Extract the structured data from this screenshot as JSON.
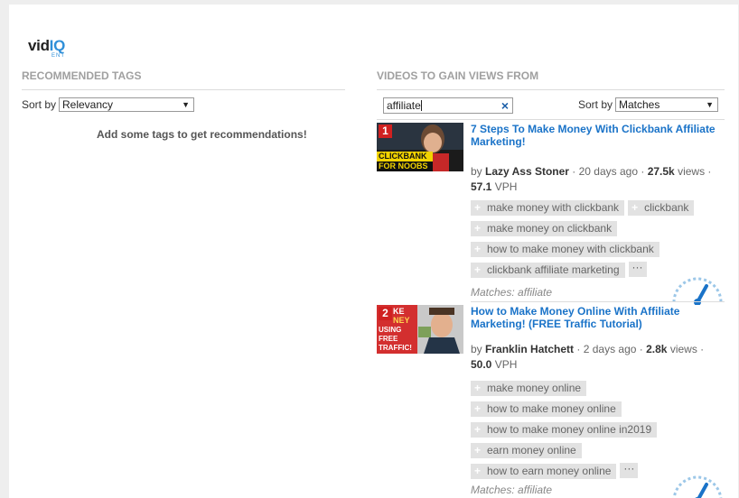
{
  "logo": {
    "text_a": "vid",
    "text_b": "IQ",
    "sub": "ENT"
  },
  "left": {
    "title": "RECOMMENDED TAGS",
    "sort_label": "Sort by",
    "sort_value": "Relevancy",
    "empty_message": "Add some tags to get recommendations!"
  },
  "right": {
    "title": "VIDEOS TO GAIN VIEWS FROM",
    "search_value": "affiliate",
    "sort_label": "Sort by",
    "sort_value": "Matches"
  },
  "videos": [
    {
      "rank": "1",
      "title": "7 Steps To Make Money With Clickbank Affiliate Marketing!",
      "by": "by",
      "channel": "Lazy Ass Stoner",
      "age": "20 days ago",
      "views": "27.5k",
      "views_label": "views",
      "vph": "57.1",
      "vph_label": "VPH",
      "tags": [
        "make money with clickbank",
        "clickbank",
        "make money on clickbank",
        "how to make money with clickbank",
        "clickbank affiliate marketing"
      ],
      "matches": "Matches: affiliate",
      "thumb_text": [
        "CLICKBANK",
        "FOR NOOBS"
      ]
    },
    {
      "rank": "2",
      "title": "How to Make Money Online With Affiliate Marketing! (FREE Traffic Tutorial)",
      "by": "by",
      "channel": "Franklin Hatchett",
      "age": "2 days ago",
      "views": "2.8k",
      "views_label": "views",
      "vph": "50.0",
      "vph_label": "VPH",
      "tags": [
        "make money online",
        "how to make money online",
        "how to make money online in2019",
        "earn money online",
        "how to earn money online"
      ],
      "matches": "Matches: affiliate",
      "thumb_text": [
        "KE",
        "NEY",
        "USING",
        "FREE",
        "TRAFFIC!"
      ]
    }
  ],
  "more_label": "···",
  "colors": {
    "link": "#1a73c8",
    "rank": "#d02020",
    "tag_bg": "#e2e2e2",
    "brand": "#2f8fd8"
  }
}
